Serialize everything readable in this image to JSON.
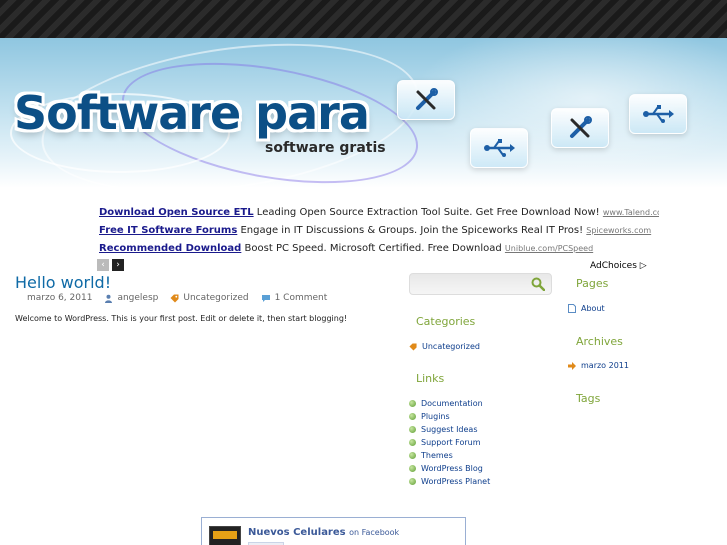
{
  "header": {
    "title": "Software para",
    "subtitle": "software gratis"
  },
  "ads": [
    {
      "title": "Download Open Source ETL",
      "desc": "Leading Open Source Extraction Tool Suite. Get Free Download Now!",
      "url": "www.Talend.com/Open_Sou"
    },
    {
      "title": "Free IT Software Forums",
      "desc": "Engage in IT Discussions & Groups. Join the Spiceworks Real IT Pros!",
      "url": "Spiceworks.com"
    },
    {
      "title": "Recommended Download",
      "desc": "Boost PC Speed. Microsoft Certified. Free Download",
      "url": "Uniblue.com/PCSpeed"
    }
  ],
  "ad_nav": {
    "prev": "‹",
    "next": "›"
  },
  "adchoices": "AdChoices",
  "post": {
    "title": "Hello world!",
    "date": "marzo 6, 2011",
    "author": "angelesp",
    "category": "Uncategorized",
    "comments": "1 Comment",
    "body": "Welcome to WordPress. This is your first post. Edit or delete it, then start blogging!"
  },
  "search": {
    "placeholder": "",
    "value": ""
  },
  "sidebar_left": {
    "categories_heading": "Categories",
    "categories": [
      "Uncategorized"
    ],
    "links_heading": "Links",
    "links": [
      "Documentation",
      "Plugins",
      "Suggest Ideas",
      "Support Forum",
      "Themes",
      "WordPress Blog",
      "WordPress Planet"
    ]
  },
  "sidebar_right": {
    "pages_heading": "Pages",
    "pages": [
      "About"
    ],
    "archives_heading": "Archives",
    "archives": [
      "marzo 2011"
    ],
    "tags_heading": "Tags"
  },
  "facebook": {
    "name": "Nuevos Celulares",
    "on": "on Facebook"
  },
  "colors": {
    "title_blue": "#0f6aa6",
    "sidebar_heading_green": "#7fa53a",
    "link_blue": "#0e3e8c",
    "ad_link": "#1a1a8c"
  }
}
